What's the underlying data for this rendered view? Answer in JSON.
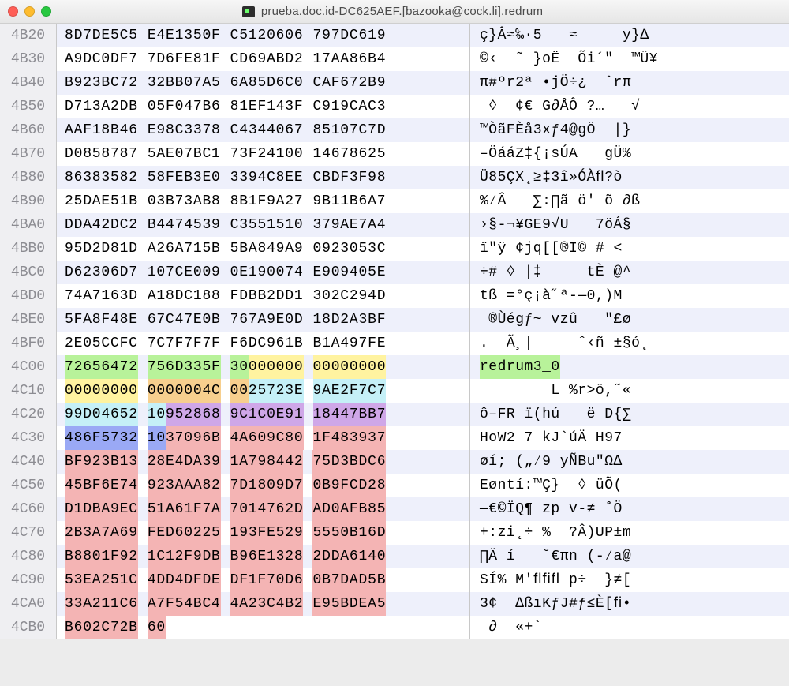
{
  "window": {
    "title": "prueba.doc.id-DC625AEF.[bazooka@cock.li].redrum"
  },
  "rows": [
    {
      "offset": "4B20",
      "hex": [
        {
          "text": "8D7DE5C5"
        },
        {
          "text": "E4E1350F"
        },
        {
          "text": "C5120606"
        },
        {
          "text": "797DC619"
        }
      ],
      "ascii": [
        {
          "text": "ç}Â≈‰·5   ≈     y}∆ "
        }
      ]
    },
    {
      "offset": "4B30",
      "hex": [
        {
          "text": "A9DC0DF7"
        },
        {
          "text": "7D6FE81F"
        },
        {
          "text": "CD69ABD2"
        },
        {
          "text": "17AA86B4"
        }
      ],
      "ascii": [
        {
          "text": "©‹  ˜ }oË  Õi´\"  ™Ü¥"
        }
      ]
    },
    {
      "offset": "4B40",
      "hex": [
        {
          "text": "B923BC72"
        },
        {
          "text": "32BB07A5"
        },
        {
          "text": "6A85D6C0"
        },
        {
          "text": "CAF672B9"
        }
      ],
      "ascii": [
        {
          "text": "π#ºr2ª •jÖ÷¿  ˆrπ"
        }
      ]
    },
    {
      "offset": "4B50",
      "hex": [
        {
          "text": "D713A2DB"
        },
        {
          "text": "05F047B6"
        },
        {
          "text": "81EF143F"
        },
        {
          "text": "C919CAC3"
        }
      ],
      "ascii": [
        {
          "text": " ◊  ¢€ G∂ÅÔ ?…   √"
        }
      ]
    },
    {
      "offset": "4B60",
      "hex": [
        {
          "text": "AAF18B46"
        },
        {
          "text": "E98C3378"
        },
        {
          "text": "C4344067"
        },
        {
          "text": "85107C7D"
        }
      ],
      "ascii": [
        {
          "text": "™ÒãFÈå3xƒ4@gÖ  |}"
        }
      ]
    },
    {
      "offset": "4B70",
      "hex": [
        {
          "text": "D0858787"
        },
        {
          "text": "5AE07BC1"
        },
        {
          "text": "73F24100"
        },
        {
          "text": "14678625"
        }
      ],
      "ascii": [
        {
          "text": "–ÖááZ‡{¡sÚA   gÜ%"
        }
      ]
    },
    {
      "offset": "4B80",
      "hex": [
        {
          "text": "86383582"
        },
        {
          "text": "58FEB3E0"
        },
        {
          "text": "3394C8EE"
        },
        {
          "text": "CBDF3F98"
        }
      ],
      "ascii": [
        {
          "text": "Ü85ÇX˛≥‡3î»ÓÀﬂ?ò"
        }
      ]
    },
    {
      "offset": "4B90",
      "hex": [
        {
          "text": "25DAE51B"
        },
        {
          "text": "03B73AB8"
        },
        {
          "text": "8B1F9A27"
        },
        {
          "text": "9B11B6A7"
        }
      ],
      "ascii": [
        {
          "text": "%⁄Â   ∑:∏ã ö' õ ∂ß"
        }
      ]
    },
    {
      "offset": "4BA0",
      "hex": [
        {
          "text": "DDA42DC2"
        },
        {
          "text": "B4474539"
        },
        {
          "text": "C3551510"
        },
        {
          "text": "379AE7A4"
        }
      ],
      "ascii": [
        {
          "text": "›§-¬¥GE9√U   7öÁ§"
        }
      ]
    },
    {
      "offset": "4BB0",
      "hex": [
        {
          "text": "95D2D81D"
        },
        {
          "text": "A26A715B"
        },
        {
          "text": "5BA849A9"
        },
        {
          "text": "0923053C"
        }
      ],
      "ascii": [
        {
          "text": "ï\"ÿ ¢jq[[®I© # <"
        }
      ]
    },
    {
      "offset": "4BC0",
      "hex": [
        {
          "text": "D62306D7"
        },
        {
          "text": "107CE009"
        },
        {
          "text": "0E190074"
        },
        {
          "text": "E909405E"
        }
      ],
      "ascii": [
        {
          "text": "÷# ◊ |‡     tÈ @^"
        }
      ]
    },
    {
      "offset": "4BD0",
      "hex": [
        {
          "text": "74A7163D"
        },
        {
          "text": "A18DC188"
        },
        {
          "text": "FDBB2DD1"
        },
        {
          "text": "302C294D"
        }
      ],
      "ascii": [
        {
          "text": "tß =°ç¡à˝ª-—0,)M"
        }
      ]
    },
    {
      "offset": "4BE0",
      "hex": [
        {
          "text": "5FA8F48E"
        },
        {
          "text": "67C47E0B"
        },
        {
          "text": "767A9E0D"
        },
        {
          "text": "18D2A3BF"
        }
      ],
      "ascii": [
        {
          "text": "_®Ùégƒ~ vzû   \"£ø"
        }
      ]
    },
    {
      "offset": "4BF0",
      "hex": [
        {
          "text": "2E05CCFC"
        },
        {
          "text": "7C7F7F7F"
        },
        {
          "text": "F6DC961B"
        },
        {
          "text": "B1A497FE"
        }
      ],
      "ascii": [
        {
          "text": ".  Ã¸|     ˆ‹ñ ±§ó˛"
        }
      ]
    },
    {
      "offset": "4C00",
      "hex": [
        {
          "segs": [
            {
              "text": "72656472",
              "hl": "green"
            }
          ]
        },
        {
          "segs": [
            {
              "text": "756D335F",
              "hl": "green"
            }
          ]
        },
        {
          "segs": [
            {
              "text": "30",
              "hl": "green"
            },
            {
              "text": "000000",
              "hl": "yellow"
            }
          ]
        },
        {
          "segs": [
            {
              "text": "00000000",
              "hl": "yellow"
            }
          ]
        }
      ],
      "ascii": [
        {
          "text": "redrum3_0",
          "hl": "green"
        }
      ]
    },
    {
      "offset": "4C10",
      "hex": [
        {
          "segs": [
            {
              "text": "00000000",
              "hl": "yellow"
            }
          ]
        },
        {
          "segs": [
            {
              "text": "0000004C",
              "hl": "orange"
            }
          ]
        },
        {
          "segs": [
            {
              "text": "00",
              "hl": "orange"
            },
            {
              "text": "25723E",
              "hl": "cyan"
            }
          ]
        },
        {
          "segs": [
            {
              "text": "9AE2F7C7",
              "hl": "cyan"
            }
          ]
        }
      ],
      "ascii": [
        {
          "text": "        L %r>ö,˜«"
        }
      ]
    },
    {
      "offset": "4C20",
      "hex": [
        {
          "segs": [
            {
              "text": "99D04652",
              "hl": "cyan"
            }
          ]
        },
        {
          "segs": [
            {
              "text": "10",
              "hl": "cyan"
            },
            {
              "text": "952868",
              "hl": "purple"
            }
          ]
        },
        {
          "segs": [
            {
              "text": "9C1C0E91",
              "hl": "purple"
            }
          ]
        },
        {
          "segs": [
            {
              "text": "18447BB7",
              "hl": "purple"
            }
          ]
        }
      ],
      "ascii": [
        {
          "text": "ô–FR ï(hú   ë D{∑"
        }
      ]
    },
    {
      "offset": "4C30",
      "hex": [
        {
          "segs": [
            {
              "text": "486F5732",
              "hl": "blue"
            }
          ]
        },
        {
          "segs": [
            {
              "text": "10",
              "hl": "blue"
            },
            {
              "text": "37096B",
              "hl": "pink"
            }
          ]
        },
        {
          "segs": [
            {
              "text": "4A609C80",
              "hl": "pink"
            }
          ]
        },
        {
          "segs": [
            {
              "text": "1F483937",
              "hl": "pink"
            }
          ]
        }
      ],
      "ascii": [
        {
          "text": "HoW2 7 kJ`úÄ H97"
        }
      ]
    },
    {
      "offset": "4C40",
      "hex": [
        {
          "segs": [
            {
              "text": "BF923B13",
              "hl": "pink"
            }
          ]
        },
        {
          "segs": [
            {
              "text": "28E4DA39",
              "hl": "pink"
            }
          ]
        },
        {
          "segs": [
            {
              "text": "1A798442",
              "hl": "pink"
            }
          ]
        },
        {
          "segs": [
            {
              "text": "75D3BDC6",
              "hl": "pink"
            }
          ]
        }
      ],
      "ascii": [
        {
          "text": "øí; („⁄9 yÑBu\"Ω∆"
        }
      ]
    },
    {
      "offset": "4C50",
      "hex": [
        {
          "segs": [
            {
              "text": "45BF6E74",
              "hl": "pink"
            }
          ]
        },
        {
          "segs": [
            {
              "text": "923AAA82",
              "hl": "pink"
            }
          ]
        },
        {
          "segs": [
            {
              "text": "7D1809D7",
              "hl": "pink"
            }
          ]
        },
        {
          "segs": [
            {
              "text": "0B9FCD28",
              "hl": "pink"
            }
          ]
        }
      ],
      "ascii": [
        {
          "text": "Eøntí:™Ç}  ◊ üÕ("
        }
      ]
    },
    {
      "offset": "4C60",
      "hex": [
        {
          "segs": [
            {
              "text": "D1DBA9EC",
              "hl": "pink"
            }
          ]
        },
        {
          "segs": [
            {
              "text": "51A61F7A",
              "hl": "pink"
            }
          ]
        },
        {
          "segs": [
            {
              "text": "7014762D",
              "hl": "pink"
            }
          ]
        },
        {
          "segs": [
            {
              "text": "AD0AFB85",
              "hl": "pink"
            }
          ]
        }
      ],
      "ascii": [
        {
          "text": "—€©ÏQ¶ zp v-≠ ˚Ö"
        }
      ]
    },
    {
      "offset": "4C70",
      "hex": [
        {
          "segs": [
            {
              "text": "2B3A7A69",
              "hl": "pink"
            }
          ]
        },
        {
          "segs": [
            {
              "text": "FED60225",
              "hl": "pink"
            }
          ]
        },
        {
          "segs": [
            {
              "text": "193FE529",
              "hl": "pink"
            }
          ]
        },
        {
          "segs": [
            {
              "text": "5550B16D",
              "hl": "pink"
            }
          ]
        }
      ],
      "ascii": [
        {
          "text": "+:zi˛÷ %  ?Â)UP±m"
        }
      ]
    },
    {
      "offset": "4C80",
      "hex": [
        {
          "segs": [
            {
              "text": "B8801F92",
              "hl": "pink"
            }
          ]
        },
        {
          "segs": [
            {
              "text": "1C12F9DB",
              "hl": "pink"
            }
          ]
        },
        {
          "segs": [
            {
              "text": "B96E1328",
              "hl": "pink"
            }
          ]
        },
        {
          "segs": [
            {
              "text": "2DDA6140",
              "hl": "pink"
            }
          ]
        }
      ],
      "ascii": [
        {
          "text": "∏Ä í   ˘€πn (-⁄a@"
        }
      ]
    },
    {
      "offset": "4C90",
      "hex": [
        {
          "segs": [
            {
              "text": "53EA251C",
              "hl": "pink"
            }
          ]
        },
        {
          "segs": [
            {
              "text": "4DD4DFDE",
              "hl": "pink"
            }
          ]
        },
        {
          "segs": [
            {
              "text": "DF1F70D6",
              "hl": "pink"
            }
          ]
        },
        {
          "segs": [
            {
              "text": "0B7DAD5B",
              "hl": "pink"
            }
          ]
        }
      ],
      "ascii": [
        {
          "text": "SÍ% M'ﬂﬁﬂ p÷  }≠["
        }
      ]
    },
    {
      "offset": "4CA0",
      "hex": [
        {
          "segs": [
            {
              "text": "33A211C6",
              "hl": "pink"
            }
          ]
        },
        {
          "segs": [
            {
              "text": "A7F54BC4",
              "hl": "pink"
            }
          ]
        },
        {
          "segs": [
            {
              "text": "4A23C4B2",
              "hl": "pink"
            }
          ]
        },
        {
          "segs": [
            {
              "text": "E95BDEA5",
              "hl": "pink"
            }
          ]
        }
      ],
      "ascii": [
        {
          "text": "3¢  ∆ßıKƒJ#ƒ≤È[ﬁ•"
        }
      ]
    },
    {
      "offset": "4CB0",
      "hex": [
        {
          "segs": [
            {
              "text": "B602C72B",
              "hl": "pink"
            }
          ]
        },
        {
          "segs": [
            {
              "text": "60",
              "hl": "pink"
            }
          ]
        }
      ],
      "ascii": [
        {
          "text": " ∂  «+`"
        }
      ]
    }
  ]
}
